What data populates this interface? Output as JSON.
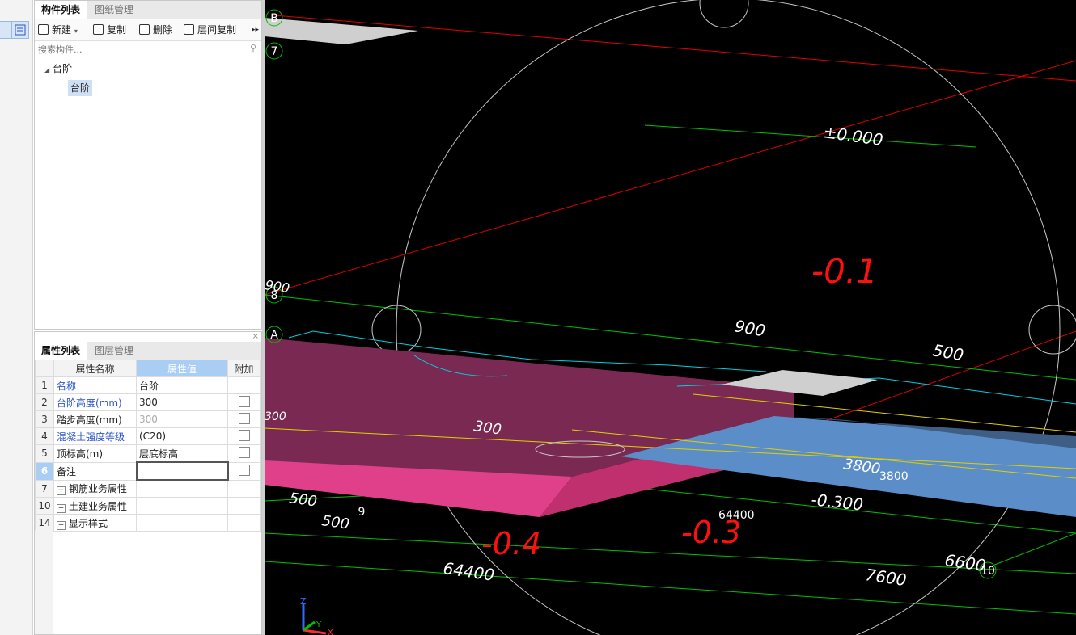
{
  "left_strip": {
    "icons": [
      "list-icon",
      "properties-icon"
    ]
  },
  "component_panel": {
    "tabs": [
      "构件列表",
      "图纸管理"
    ],
    "toolbar": {
      "new": "新建",
      "copy": "复制",
      "delete": "删除",
      "floor_copy": "层间复制"
    },
    "search_placeholder": "搜索构件...",
    "tree": {
      "category": "台阶",
      "item": "台阶"
    }
  },
  "properties_panel": {
    "tabs": [
      "属性列表",
      "图层管理"
    ],
    "headers": {
      "name": "属性名称",
      "value": "属性值",
      "extra": "附加"
    },
    "rows": [
      {
        "num": "1",
        "name": "名称",
        "value": "台阶"
      },
      {
        "num": "2",
        "name": "台阶高度(mm)",
        "value": "300"
      },
      {
        "num": "3",
        "name": "踏步高度(mm)",
        "value": "300"
      },
      {
        "num": "4",
        "name": "混凝土强度等级",
        "value": "(C20)"
      },
      {
        "num": "5",
        "name": "顶标高(m)",
        "value": "层底标高"
      },
      {
        "num": "6",
        "name": "备注",
        "value": ""
      },
      {
        "num": "7",
        "name": "钢筋业务属性",
        "value": ""
      },
      {
        "num": "10",
        "name": "土建业务属性",
        "value": ""
      },
      {
        "num": "14",
        "name": "显示样式",
        "value": ""
      }
    ]
  },
  "viewport": {
    "axis_labels": [
      "B",
      "7",
      "8",
      "A",
      "9",
      "10"
    ],
    "dimension_texts": [
      "±0.000",
      "900",
      "500",
      "300",
      "3800",
      "3800",
      "-0.300",
      "64400",
      "500",
      "500",
      "64400",
      "6600",
      "7600",
      "900",
      "300"
    ],
    "handwritten_notes": [
      "-0.1",
      "-0.4",
      "-0.3"
    ],
    "axis_triad": [
      "Z",
      "Y",
      "X"
    ],
    "colors": {
      "background": "#000000",
      "grid_green": "#00c000",
      "axis_red": "#e00000",
      "slab_pink": "#e0408a",
      "slab_blue": "#5b8ec9",
      "outline_cyan": "#00d0e0",
      "note_red": "#ff1010"
    }
  }
}
